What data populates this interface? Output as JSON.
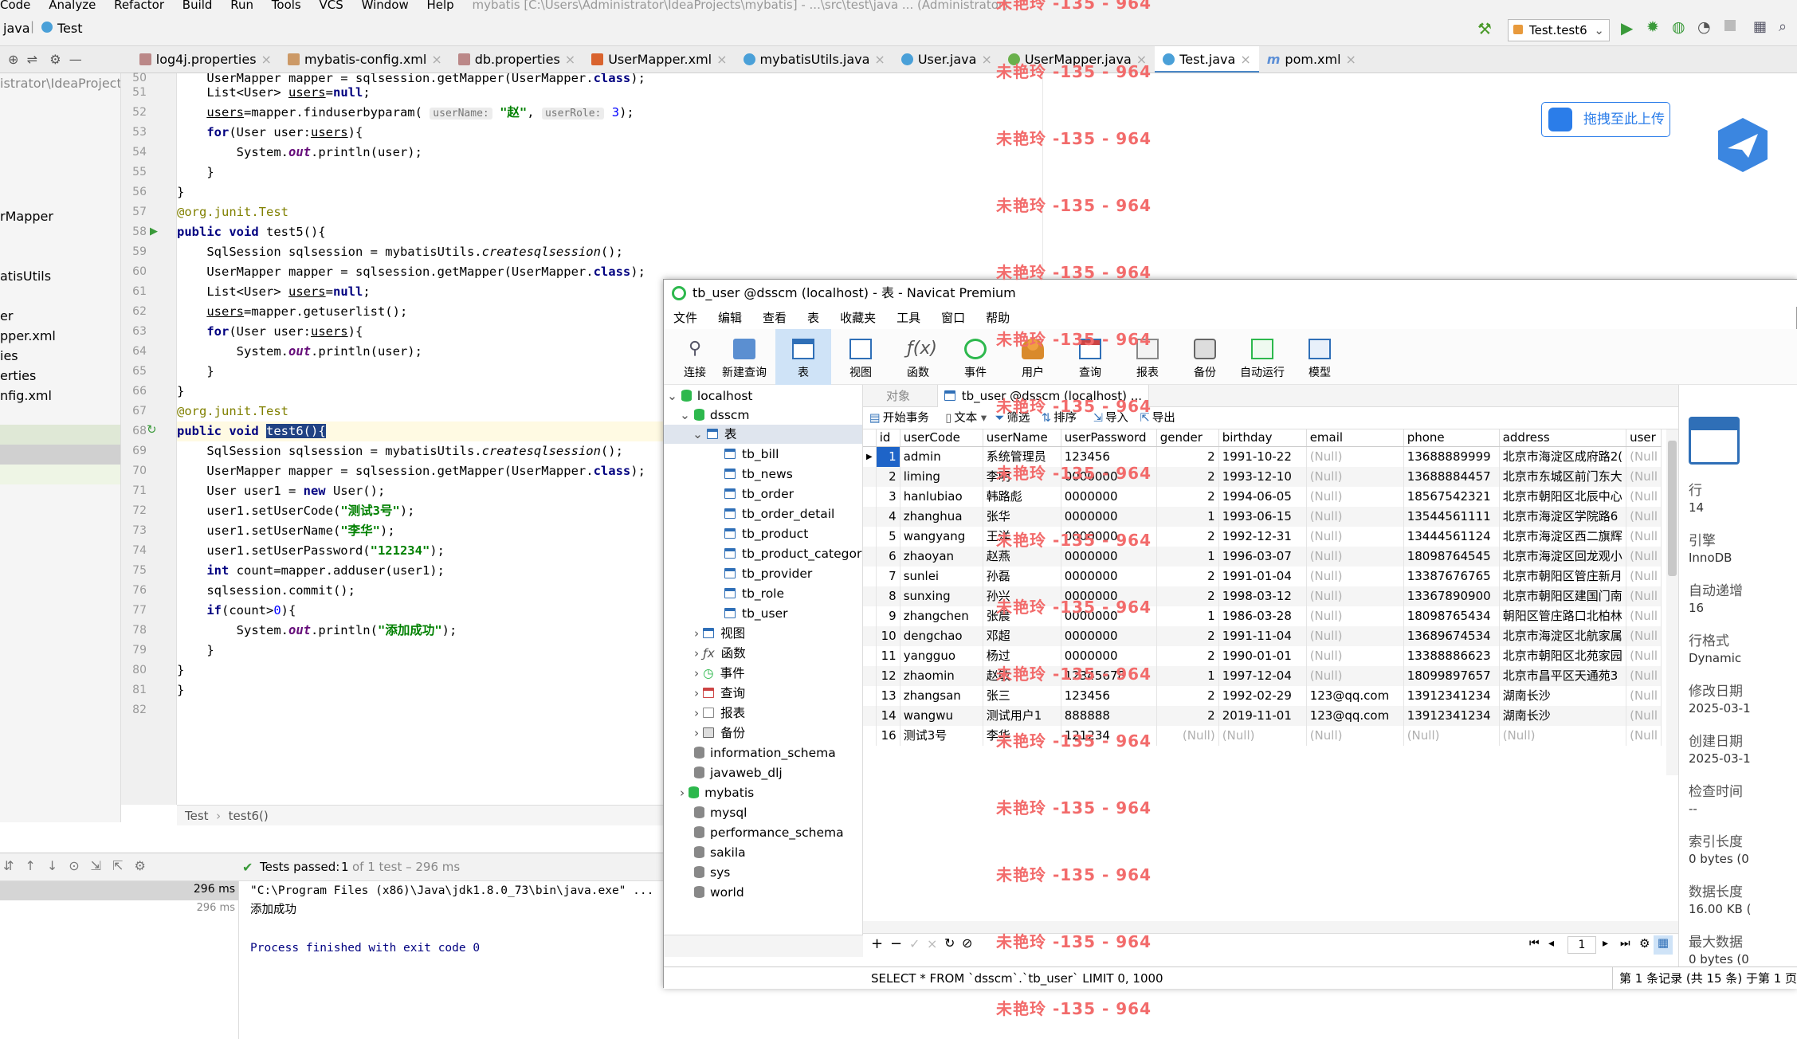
{
  "menubar": {
    "items": [
      "Code",
      "Analyze",
      "Refactor",
      "Build",
      "Run",
      "Tools",
      "VCS",
      "Window",
      "Help"
    ],
    "window_title": "mybatis [C:\\Users\\Administrator\\IdeaProjects\\mybatis] - ...\\src\\test\\java ... (Administrator)"
  },
  "toolbar": {
    "crumb_java": "java",
    "crumb_class": "Test",
    "run_config": "Test.test6"
  },
  "tabs": [
    "log4j.properties",
    "mybatis-config.xml",
    "db.properties",
    "UserMapper.xml",
    "mybatisUtils.java",
    "User.java",
    "UserMapper.java",
    "Test.java",
    "pom.xml"
  ],
  "project": {
    "path": "istrator\\IdeaProjects",
    "items": [
      "rMapper",
      "atisUtils",
      "er",
      "pper.xml",
      "ies",
      "erties",
      "nfig.xml"
    ]
  },
  "editor": {
    "line_numbers": [
      "50",
      "51",
      "52",
      "53",
      "54",
      "55",
      "56",
      "57",
      "58",
      "59",
      "60",
      "61",
      "62",
      "63",
      "64",
      "65",
      "66",
      "67",
      "68",
      "69",
      "70",
      "71",
      "72",
      "73",
      "74",
      "75",
      "76",
      "77",
      "78",
      "79",
      "80",
      "81",
      "82"
    ],
    "hint_username": "userName:",
    "hint_userrole": "userRole:",
    "str_zhao": "\"赵\"",
    "str_test3": "\"测试3号\"",
    "str_lihua": "\"李华\"",
    "str_pwd": "\"121234\"",
    "str_success": "\"添加成功\""
  },
  "breadcrumb": {
    "class": "Test",
    "method": "test6()"
  },
  "run": {
    "status_prefix": "Tests passed:",
    "status_count": "1",
    "status_suffix": "of 1 test – 296 ms",
    "time1": "296 ms",
    "time2": "296 ms",
    "cmd": "\"C:\\Program Files (x86)\\Java\\jdk1.8.0_73\\bin\\java.exe\" ...",
    "output1": "添加成功",
    "output2": "Process finished with exit code 0"
  },
  "upload_button": "拖拽至此上传",
  "watermark": "未艳玲 -135 - 964",
  "navicat": {
    "title": "tb_user @dsscm (localhost) - 表 - Navicat Premium",
    "menu": [
      "文件",
      "编辑",
      "查看",
      "表",
      "收藏夹",
      "工具",
      "窗口",
      "帮助"
    ],
    "toolbar": [
      "连接",
      "新建查询",
      "表",
      "视图",
      "函数",
      "事件",
      "用户",
      "查询",
      "报表",
      "备份",
      "自动运行",
      "模型"
    ],
    "tree": {
      "localhost": "localhost",
      "dsscm": "dsscm",
      "tables_node": "表",
      "tables": [
        "tb_bill",
        "tb_news",
        "tb_order",
        "tb_order_detail",
        "tb_product",
        "tb_product_category",
        "tb_provider",
        "tb_role",
        "tb_user"
      ],
      "other_nodes": [
        "视图",
        "函数",
        "事件",
        "查询",
        "报表",
        "备份"
      ],
      "databases": [
        "information_schema",
        "javaweb_dlj",
        "mybatis",
        "mysql",
        "performance_schema",
        "sakila",
        "sys",
        "world"
      ]
    },
    "object_tab": "对象",
    "table_tab": "tb_user @dsscm (localhost) ...",
    "subtoolbar": [
      "开始事务",
      "文本",
      "筛选",
      "排序",
      "导入",
      "导出"
    ],
    "columns": [
      "id",
      "userCode",
      "userName",
      "userPassword",
      "gender",
      "birthday",
      "email",
      "phone",
      "address",
      "user"
    ],
    "rows": [
      [
        "1",
        "admin",
        "系统管理员",
        "123456",
        "2",
        "1991-10-22",
        "(Null)",
        "13688889999",
        "北京市海淀区成府路2("
      ],
      [
        "2",
        "liming",
        "李明",
        "0000000",
        "2",
        "1993-12-10",
        "(Null)",
        "13688884457",
        "北京市东城区前门东大"
      ],
      [
        "3",
        "hanlubiao",
        "韩路彪",
        "0000000",
        "2",
        "1994-06-05",
        "(Null)",
        "18567542321",
        "北京市朝阳区北辰中心"
      ],
      [
        "4",
        "zhanghua",
        "张华",
        "0000000",
        "1",
        "1993-06-15",
        "(Null)",
        "13544561111",
        "北京市海淀区学院路6"
      ],
      [
        "5",
        "wangyang",
        "王洋",
        "0000000",
        "2",
        "1992-12-31",
        "(Null)",
        "13444561124",
        "北京市海淀区西二旗辉"
      ],
      [
        "6",
        "zhaoyan",
        "赵燕",
        "0000000",
        "1",
        "1996-03-07",
        "(Null)",
        "18098764545",
        "北京市海淀区回龙观小"
      ],
      [
        "7",
        "sunlei",
        "孙磊",
        "0000000",
        "2",
        "1991-01-04",
        "(Null)",
        "13387676765",
        "北京市朝阳区管庄新月"
      ],
      [
        "8",
        "sunxing",
        "孙兴",
        "0000000",
        "2",
        "1998-03-12",
        "(Null)",
        "13367890900",
        "北京市朝阳区建国门南"
      ],
      [
        "9",
        "zhangchen",
        "张晨",
        "0000000",
        "1",
        "1986-03-28",
        "(Null)",
        "18098765434",
        "朝阳区管庄路口北柏林"
      ],
      [
        "10",
        "dengchao",
        "邓超",
        "0000000",
        "2",
        "1991-11-04",
        "(Null)",
        "13689674534",
        "北京市海淀区北航家属"
      ],
      [
        "11",
        "yangguo",
        "杨过",
        "0000000",
        "2",
        "1990-01-01",
        "(Null)",
        "13388886623",
        "北京市朝阳区北苑家园"
      ],
      [
        "12",
        "zhaomin",
        "赵敏",
        "12345678",
        "1",
        "1997-12-04",
        "(Null)",
        "18099897657",
        "北京市昌平区天通苑3"
      ],
      [
        "13",
        "zhangsan",
        "张三",
        "123456",
        "2",
        "1992-02-29",
        "123@qq.com",
        "13912341234",
        "湖南长沙"
      ],
      [
        "14",
        "wangwu",
        "测试用户1",
        "888888",
        "2",
        "2019-11-01",
        "123@qq.com",
        "13912341234",
        "湖南长沙"
      ],
      [
        "16",
        "测试3号",
        "李华",
        "121234",
        "(Null)",
        "(Null)",
        "(Null)",
        "(Null)",
        "(Null)"
      ]
    ],
    "last_col_null": "(Null",
    "page_number": "1",
    "sql": "SELECT * FROM `dsscm`.`tb_user` LIMIT 0, 1000",
    "record_info": "第 1 条记录 (共 15 条) 于第 1 页",
    "info": [
      {
        "k": "行",
        "v": "14"
      },
      {
        "k": "引擎",
        "v": "InnoDB"
      },
      {
        "k": "自动递增",
        "v": "16"
      },
      {
        "k": "行格式",
        "v": "Dynamic"
      },
      {
        "k": "修改日期",
        "v": "2025-03-1"
      },
      {
        "k": "创建日期",
        "v": "2025-03-1"
      },
      {
        "k": "检查时间",
        "v": "--"
      },
      {
        "k": "索引长度",
        "v": "0 bytes (0"
      },
      {
        "k": "数据长度",
        "v": "16.00 KB ("
      },
      {
        "k": "最大数据",
        "v": "0 bytes (0"
      }
    ]
  }
}
